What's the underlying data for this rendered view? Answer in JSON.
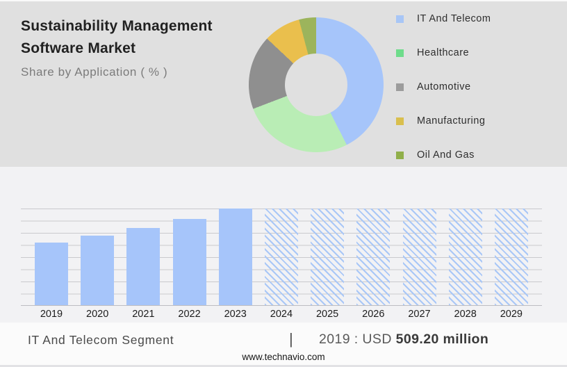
{
  "header": {
    "title_line1": "Sustainability Management",
    "title_line2": "Software Market",
    "subtitle": "Share by Application ( % )"
  },
  "legend": {
    "items": [
      {
        "label": "IT And Telecom",
        "color": "#a8c6f6"
      },
      {
        "label": "Healthcare",
        "color": "#6edc8b"
      },
      {
        "label": "Automotive",
        "color": "#9c9c9c"
      },
      {
        "label": "Manufacturing",
        "color": "#d9bf4e"
      },
      {
        "label": "Oil And Gas",
        "color": "#90af4a"
      }
    ]
  },
  "chart_data": [
    {
      "type": "pie",
      "subtype": "donut",
      "title": "Share by Application ( % )",
      "labels": [
        "IT And Telecom",
        "Healthcare",
        "Automotive",
        "Manufacturing",
        "Oil And Gas"
      ],
      "values_pct": [
        42.5,
        26.7,
        17.8,
        8.9,
        4.1
      ],
      "colors": [
        "#a6c5fa",
        "#b9edb5",
        "#8f8f8f",
        "#eabf4d",
        "#9cb45c"
      ],
      "start_angle_deg": 0,
      "direction": "clockwise",
      "inner_radius_ratio": 0.46,
      "legend_position": "right"
    },
    {
      "type": "bar",
      "categories": [
        "2019",
        "2020",
        "2021",
        "2022",
        "2023",
        "2024",
        "2025",
        "2026",
        "2027",
        "2028",
        "2029"
      ],
      "series": [
        {
          "name": "IT And Telecom Segment (USD million)",
          "values": [
            509.2,
            565,
            627,
            696,
            783,
            null,
            null,
            null,
            null,
            null,
            null
          ]
        }
      ],
      "bar_heights_pct": [
        65,
        72.1,
        80,
        88.9,
        100,
        100,
        100,
        100,
        100,
        100,
        100
      ],
      "bar_styles": [
        "solid",
        "solid",
        "solid",
        "solid",
        "solid",
        "hatched",
        "hatched",
        "hatched",
        "hatched",
        "hatched",
        "hatched"
      ],
      "bar_color": "#a6c5fa",
      "hatched_meaning": "forecast",
      "grid": "horizontal",
      "gridline_count": 9,
      "xlabel": "",
      "ylabel": "",
      "known_point": {
        "year": "2019",
        "value": "USD 509.20 million"
      }
    }
  ],
  "footer": {
    "segment_label": "IT And Telecom Segment",
    "divider": "|",
    "value_prefix": "2019 : USD",
    "value_bold": "509.20 million",
    "website": "www.technavio.com"
  }
}
